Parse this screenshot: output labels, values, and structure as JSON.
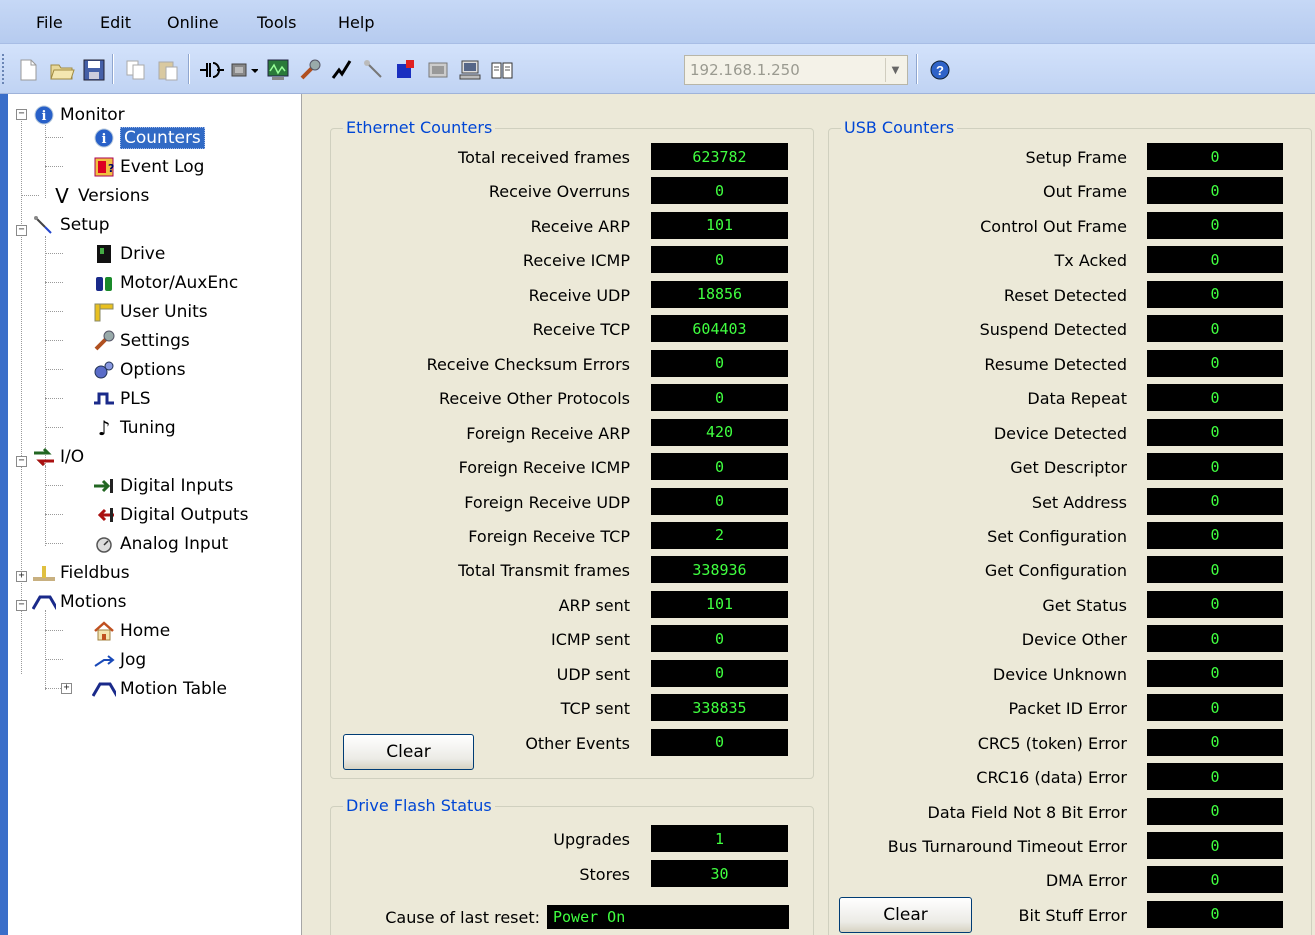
{
  "menu": [
    "File",
    "Edit",
    "Online",
    "Tools",
    "Help"
  ],
  "toolbar": {
    "ip_address": "192.168.1.250",
    "icons": [
      "new-icon",
      "open-icon",
      "save-icon",
      "copy-icon",
      "paste-icon",
      "connect-icon",
      "drive-icon",
      "scope-icon",
      "wrench-icon",
      "lightning-icon",
      "probe-icon",
      "flag-icon",
      "window-icon",
      "computer-icon",
      "book-icon",
      "help-icon"
    ]
  },
  "tree": {
    "monitor": "Monitor",
    "counters": "Counters",
    "event_log": "Event Log",
    "versions": "Versions",
    "setup": "Setup",
    "drive": "Drive",
    "motor": "Motor/AuxEnc",
    "user_units": "User Units",
    "settings": "Settings",
    "options": "Options",
    "pls": "PLS",
    "tuning": "Tuning",
    "io": "I/O",
    "digital_inputs": "Digital Inputs",
    "digital_outputs": "Digital Outputs",
    "analog_input": "Analog Input",
    "fieldbus": "Fieldbus",
    "motions": "Motions",
    "home": "Home",
    "jog": "Jog",
    "motion_table": "Motion Table"
  },
  "ethernet": {
    "title": "Ethernet Counters",
    "rows": [
      {
        "label": "Total received frames",
        "value": "623782"
      },
      {
        "label": "Receive Overruns",
        "value": "0"
      },
      {
        "label": "Receive ARP",
        "value": "101"
      },
      {
        "label": "Receive ICMP",
        "value": "0"
      },
      {
        "label": "Receive UDP",
        "value": "18856"
      },
      {
        "label": "Receive TCP",
        "value": "604403"
      },
      {
        "label": "Receive Checksum Errors",
        "value": "0"
      },
      {
        "label": "Receive Other Protocols",
        "value": "0"
      },
      {
        "label": "Foreign Receive ARP",
        "value": "420"
      },
      {
        "label": "Foreign Receive ICMP",
        "value": "0"
      },
      {
        "label": "Foreign Receive UDP",
        "value": "0"
      },
      {
        "label": "Foreign Receive TCP",
        "value": "2"
      },
      {
        "label": "Total Transmit frames",
        "value": "338936"
      },
      {
        "label": "ARP sent",
        "value": "101"
      },
      {
        "label": "ICMP sent",
        "value": "0"
      },
      {
        "label": "UDP sent",
        "value": "0"
      },
      {
        "label": "TCP sent",
        "value": "338835"
      },
      {
        "label": "Other Events",
        "value": "0"
      }
    ],
    "clear": "Clear"
  },
  "flash": {
    "title": "Drive Flash Status",
    "upgrades_label": "Upgrades",
    "upgrades": "1",
    "stores_label": "Stores",
    "stores": "30",
    "reset_label": "Cause of last reset:",
    "reset_value": "Power On"
  },
  "usb": {
    "title": "USB Counters",
    "rows": [
      {
        "label": "Setup Frame",
        "value": "0"
      },
      {
        "label": "Out Frame",
        "value": "0"
      },
      {
        "label": "Control Out Frame",
        "value": "0"
      },
      {
        "label": "Tx Acked",
        "value": "0"
      },
      {
        "label": "Reset Detected",
        "value": "0"
      },
      {
        "label": "Suspend Detected",
        "value": "0"
      },
      {
        "label": "Resume Detected",
        "value": "0"
      },
      {
        "label": "Data Repeat",
        "value": "0"
      },
      {
        "label": "Device Detected",
        "value": "0"
      },
      {
        "label": "Get Descriptor",
        "value": "0"
      },
      {
        "label": "Set Address",
        "value": "0"
      },
      {
        "label": "Set Configuration",
        "value": "0"
      },
      {
        "label": "Get Configuration",
        "value": "0"
      },
      {
        "label": "Get Status",
        "value": "0"
      },
      {
        "label": "Device Other",
        "value": "0"
      },
      {
        "label": "Device Unknown",
        "value": "0"
      },
      {
        "label": "Packet ID Error",
        "value": "0"
      },
      {
        "label": "CRC5 (token) Error",
        "value": "0"
      },
      {
        "label": "CRC16 (data) Error",
        "value": "0"
      },
      {
        "label": "Data Field Not 8 Bit Error",
        "value": "0"
      },
      {
        "label": "Bus Turnaround Timeout Error",
        "value": "0"
      },
      {
        "label": "DMA Error",
        "value": "0"
      },
      {
        "label": "Bit Stuff Error",
        "value": "0"
      }
    ],
    "clear": "Clear"
  },
  "colors": {
    "value_text": "#40ff40",
    "value_bg": "#000000",
    "group_title": "#0046d5",
    "selection": "#316ac5"
  }
}
